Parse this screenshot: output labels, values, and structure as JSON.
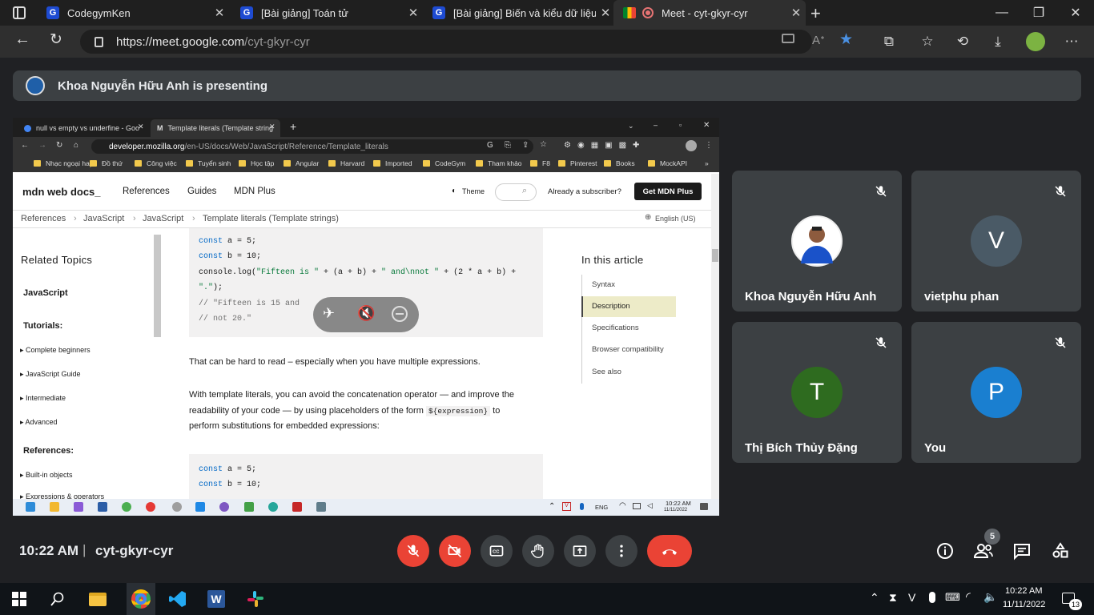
{
  "browser": {
    "tabs": [
      {
        "title": "CodegymKen",
        "favicon": "G"
      },
      {
        "title": "[Bài giảng] Toán tử",
        "favicon": "G"
      },
      {
        "title": "[Bài giảng] Biến và kiểu dữ liệu (",
        "favicon": "G"
      },
      {
        "title": "Meet - cyt-gkyr-cyr",
        "favicon": "meet"
      }
    ],
    "url_host": "https://meet.google.com",
    "url_path": "/cyt-gkyr-cyr"
  },
  "meet": {
    "presenting_banner": "Khoa Nguyễn Hữu Anh is presenting",
    "time": "10:22 AM",
    "separator": "|",
    "meeting_code": "cyt-gkyr-cyr",
    "participants_count": "5",
    "participants": [
      {
        "name": "Khoa Nguyễn Hữu Anh",
        "initial": "",
        "color": "#ffffff"
      },
      {
        "name": "vietphu phan",
        "initial": "V",
        "color": "#4a5a66"
      },
      {
        "name": "Thị Bích Thủy Đặng",
        "initial": "T",
        "color": "#2e6b1f"
      },
      {
        "name": "You",
        "initial": "P",
        "color": "#1a7fd0"
      }
    ]
  },
  "shared": {
    "tabs": [
      {
        "title": "null vs empty vs underfine - Goo"
      },
      {
        "title": "Template literals (Template string"
      }
    ],
    "url_host": "developer.mozilla.org",
    "url_path": "/en-US/docs/Web/JavaScript/Reference/Template_literals",
    "bookmarks": [
      "Nhạc ngoại hay",
      "Đồ thứ",
      "Công việc",
      "Tuyển sinh",
      "Học tập",
      "Angular",
      "Harvard",
      "Imported",
      "CodeGym",
      "Tham khảo",
      "F8",
      "Pinterest",
      "Books",
      "MockAPI"
    ],
    "logo": "mdn web docs_",
    "nav": [
      "References",
      "Guides",
      "MDN Plus"
    ],
    "theme": "Theme",
    "already": "Already a subscriber?",
    "get_plus": "Get MDN Plus",
    "breadcrumbs": [
      "References",
      "JavaScript",
      "JavaScript",
      "Template literals (Template strings)"
    ],
    "language": "English (US)",
    "sidebar": {
      "related": "Related Topics",
      "javascript": "JavaScript",
      "tutorials": "Tutorials:",
      "tutorial_items": [
        "Complete beginners",
        "JavaScript Guide",
        "Intermediate",
        "Advanced"
      ],
      "references": "References:",
      "reference_items": [
        "Built-in objects",
        "Expressions & operators"
      ]
    },
    "code1": [
      "const a = 5;",
      "const b = 10;",
      "console.log(\"Fifteen is \" + (a + b) + \" and\\nnot \" + (2 * a + b) +",
      "\".\");",
      "// \"Fifteen is 15 and",
      "// not 20.\""
    ],
    "para1": "That can be hard to read – especially when you have multiple expressions.",
    "para2a": "With template literals, you can avoid the concatenation operator — and improve the",
    "para2b": "readability of your code — by using placeholders of the form",
    "para2code": "${expression}",
    "para2c": "to",
    "para2d": "perform substitutions for embedded expressions:",
    "code2": [
      "const a = 5;",
      "const b = 10;"
    ],
    "toc_title": "In this article",
    "toc": [
      "Syntax",
      "Description",
      "Specifications",
      "Browser compatibility",
      "See also"
    ],
    "taskbar_lang": "ENG",
    "taskbar_time": "10:22 AM",
    "taskbar_date": "11/11/2022"
  },
  "windows": {
    "time": "10:22 AM",
    "date": "11/11/2022",
    "notifications": "13"
  }
}
